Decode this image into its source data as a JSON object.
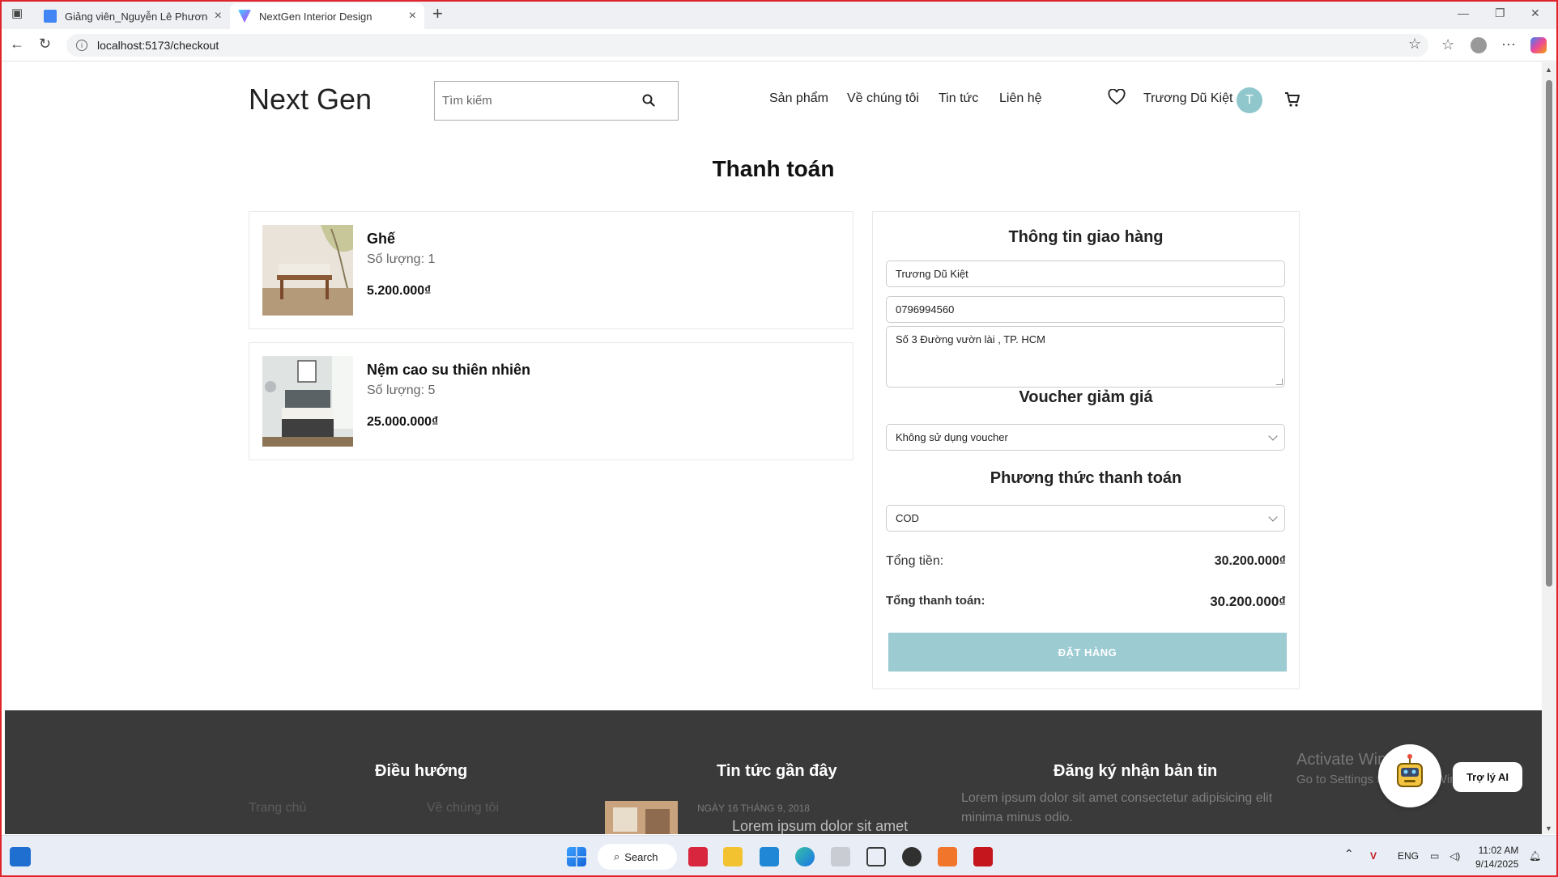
{
  "browser": {
    "tabs": [
      {
        "title": "Giảng viên_Nguyễn Lê Phương_V",
        "active": false,
        "icon": "google-docs-icon",
        "color": "#4285f4"
      },
      {
        "title": "NextGen Interior Design",
        "active": true,
        "icon": "vite-icon",
        "color": "#a259ff"
      }
    ],
    "url": "localhost:5173/checkout"
  },
  "header": {
    "logo": "Next Gen",
    "search_placeholder": "Tìm kiếm",
    "nav": [
      "Sản phẩm",
      "Về chúng tôi",
      "Tin tức",
      "Liên hệ"
    ],
    "user_name": "Trương Dũ Kiệt",
    "avatar_initial": "T",
    "accent": "#8fc7cd"
  },
  "page_title": "Thanh toán",
  "cart_items": [
    {
      "name": "Ghế",
      "quantity": "Số lượng: 1",
      "price": "5.200.000₫"
    },
    {
      "name": "Nệm cao su thiên nhiên",
      "quantity": "Số lượng: 5",
      "price": "25.000.000₫"
    }
  ],
  "shipping": {
    "heading": "Thông tin giao hàng",
    "name": "Trương Dũ Kiệt",
    "phone": "0796994560",
    "address": "Số 3 Đường vườn lài , TP. HCM"
  },
  "voucher": {
    "heading": "Voucher giảm giá",
    "selected": "Không sử dụng voucher"
  },
  "payment": {
    "heading": "Phương thức thanh toán",
    "selected": "COD"
  },
  "totals": {
    "subtotal_label": "Tổng tiền:",
    "subtotal_value": "30.200.000₫",
    "total_label": "Tổng thanh toán:",
    "total_value": "30.200.000₫"
  },
  "order_button": "ĐẶT HÀNG",
  "footer": {
    "nav_heading": "Điều hướng",
    "nav_links": [
      "Trang chủ",
      "Về chúng tôi"
    ],
    "news_heading": "Tin tức gần đây",
    "news_date": "NGÀY 16 THÁNG 9, 2018",
    "news_title": "Lorem ipsum dolor sit amet",
    "newsletter_heading": "Đăng ký nhận bản tin",
    "newsletter_text": "Lorem ipsum dolor sit amet consectetur adipisicing elit minima minus odio."
  },
  "windows_watermark": {
    "line1": "Activate Windows",
    "line2": "Go to Settings to activate Windows."
  },
  "ai_assistant": "Trợ lý AI",
  "taskbar": {
    "search": "Search",
    "lang": "ENG",
    "time": "11:02 AM",
    "date": "9/14/2025"
  }
}
